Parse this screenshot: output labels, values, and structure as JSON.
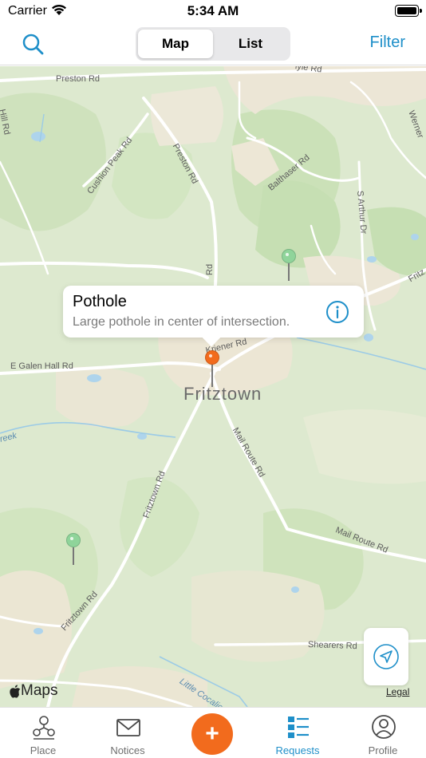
{
  "status_bar": {
    "carrier": "Carrier",
    "time": "5:34 AM"
  },
  "nav": {
    "segments": [
      {
        "label": "Map",
        "active": true
      },
      {
        "label": "List",
        "active": false
      }
    ],
    "filter_label": "Filter"
  },
  "map": {
    "town_label": "Fritztown",
    "road_labels": [
      "Preston Rd",
      "Preston Rd",
      "Hill Rd",
      "Cushion Peak Rd",
      "Balthaser Rd",
      "S Arthur Dr",
      "Rd",
      "E Galen Hall Rd",
      "Kriener Rd",
      "Mail Route Rd",
      "Mail Route Rd",
      "Fritztown Rd",
      "Fritztown Rd",
      "Shearers Rd",
      "Werner",
      "Fritz",
      "lyle Rd"
    ],
    "water_labels": [
      "reek",
      "Little Cocalico"
    ],
    "callout": {
      "title": "Pothole",
      "subtitle": "Large pothole in center of intersection."
    },
    "pins": [
      {
        "color": "#8fd49a",
        "status": "other"
      },
      {
        "color": "#f26b1d",
        "status": "selected"
      },
      {
        "color": "#8fd49a",
        "status": "other"
      }
    ],
    "attribution": "Maps",
    "legal_label": "Legal"
  },
  "tabs": [
    {
      "label": "Place",
      "icon": "place-icon",
      "selected": false
    },
    {
      "label": "Notices",
      "icon": "envelope-icon",
      "selected": false
    },
    {
      "label": "Requests",
      "icon": "requests-list-icon",
      "selected": true
    },
    {
      "label": "Profile",
      "icon": "profile-icon",
      "selected": false
    }
  ],
  "colors": {
    "accent": "#1e8fc9",
    "add_button": "#f26b1d",
    "pin_green": "#8fd49a",
    "pin_orange": "#f26b1d"
  }
}
